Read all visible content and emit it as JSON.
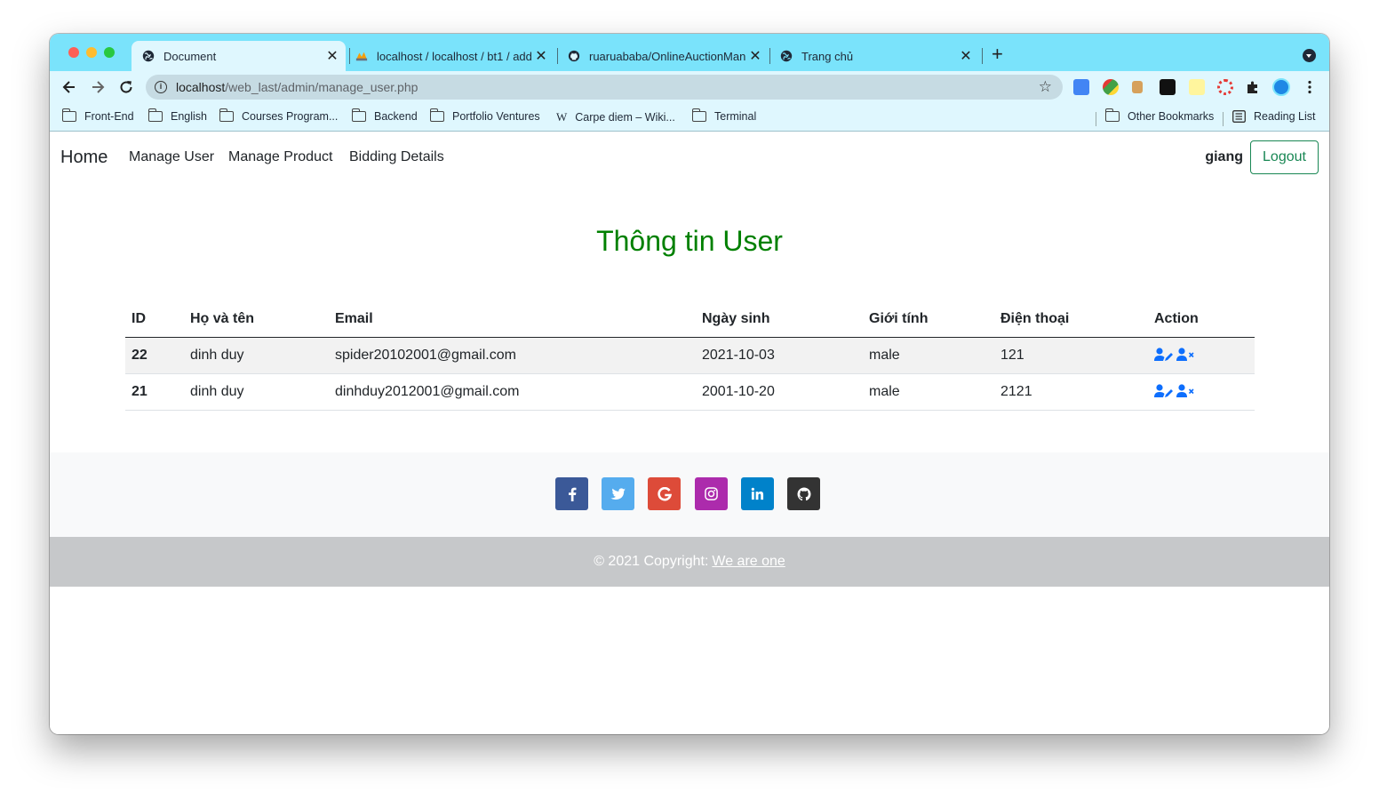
{
  "browser": {
    "tabs": [
      {
        "title": "Document",
        "active": true
      },
      {
        "title": "localhost / localhost / bt1 / add"
      },
      {
        "title": "ruaruababa/OnlineAuctionMan"
      },
      {
        "title": "Trang chủ"
      }
    ],
    "url_host": "localhost",
    "url_path": "/web_last/admin/manage_user.php",
    "bookmarks": [
      "Front-End",
      "English",
      "Courses Program...",
      "Backend",
      "Portfolio Ventures",
      "Carpe diem – Wiki...",
      "Terminal"
    ],
    "bookmarks_right": [
      "Other Bookmarks",
      "Reading List"
    ]
  },
  "navbar": {
    "brand": "Home",
    "links": [
      "Manage User",
      "Manage Product",
      "Bidding Details"
    ],
    "username": "giang",
    "logout_label": "Logout"
  },
  "main": {
    "title": "Thông tin User",
    "columns": [
      "ID",
      "Họ và tên",
      "Email",
      "Ngày sinh",
      "Giới tính",
      "Điện thoại",
      "Action"
    ],
    "rows": [
      {
        "id": "22",
        "name": "dinh duy",
        "email": "spider20102001@gmail.com",
        "dob": "2021-10-03",
        "gender": "male",
        "phone": "121"
      },
      {
        "id": "21",
        "name": "dinh duy",
        "email": "dinhduy2012001@gmail.com",
        "dob": "2001-10-20",
        "gender": "male",
        "phone": "2121"
      }
    ]
  },
  "footer": {
    "social": [
      "facebook-icon",
      "twitter-icon",
      "google-icon",
      "instagram-icon",
      "linkedin-icon",
      "github-icon"
    ],
    "social_colors": [
      "#3b5998",
      "#55acee",
      "#dd4b39",
      "#ac2bac",
      "#0082ca",
      "#333333"
    ],
    "copyright": "© 2021 Copyright:",
    "copyright_link": "We are one"
  },
  "colors": {
    "heading": "#008000",
    "logout": "#198754",
    "action_icon": "#0d6efd",
    "tabstrip": "#7ae3fb"
  }
}
